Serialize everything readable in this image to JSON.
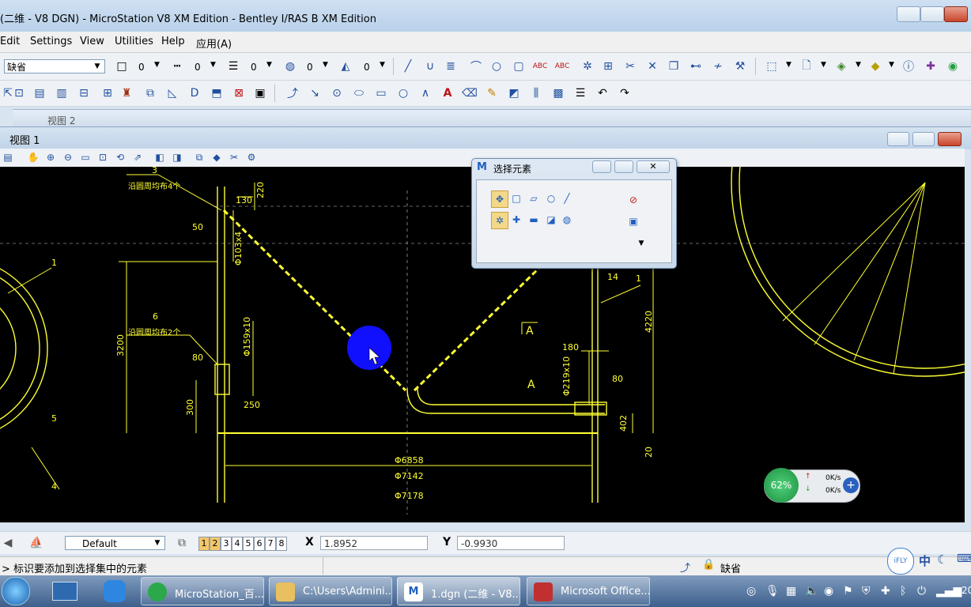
{
  "window": {
    "title": "(二维 - V8 DGN) - MicroStation V8 XM Edition - Bentley I/RAS B XM Edition"
  },
  "menubar": {
    "items": [
      "Edit",
      "Settings",
      "View",
      "Utilities",
      "Help",
      "应用(A)"
    ]
  },
  "toolbar1": {
    "level_combo": "缺省",
    "color_value": "0",
    "style_value": "0",
    "weight_value": "0",
    "transparency_value": "0",
    "priority_value": "0"
  },
  "views": {
    "view2_title": "视图 2",
    "view1_title": "视图 1"
  },
  "drawing": {
    "labels": [
      {
        "name": "label-3",
        "text": "3"
      },
      {
        "name": "label-sleeve4",
        "text": "沿圆周均布4个"
      },
      {
        "name": "label-130",
        "text": "130"
      },
      {
        "name": "label-220",
        "text": "220"
      },
      {
        "name": "label-50",
        "text": "50"
      },
      {
        "name": "label-d103",
        "text": "Φ103x4"
      },
      {
        "name": "label-1-left",
        "text": "1"
      },
      {
        "name": "label-6",
        "text": "6"
      },
      {
        "name": "label-sleeve2",
        "text": "沿圆周均布2个"
      },
      {
        "name": "label-3200",
        "text": "3200"
      },
      {
        "name": "label-80-left",
        "text": "80"
      },
      {
        "name": "label-d159",
        "text": "Φ159x10"
      },
      {
        "name": "label-250",
        "text": "250"
      },
      {
        "name": "label-300",
        "text": "300"
      },
      {
        "name": "label-d6858",
        "text": "Φ6858"
      },
      {
        "name": "label-d7142",
        "text": "Φ7142"
      },
      {
        "name": "label-d7178",
        "text": "Φ7178"
      },
      {
        "name": "label-4",
        "text": "4"
      },
      {
        "name": "label-5",
        "text": "5"
      },
      {
        "name": "label-A-top",
        "text": "A"
      },
      {
        "name": "label-A-bottom",
        "text": "A"
      },
      {
        "name": "label-180",
        "text": "180"
      },
      {
        "name": "label-d219",
        "text": "Φ219x10"
      },
      {
        "name": "label-80-right",
        "text": "80"
      },
      {
        "name": "label-14",
        "text": "14"
      },
      {
        "name": "label-1-right",
        "text": "1"
      },
      {
        "name": "label-4220",
        "text": "4220"
      },
      {
        "name": "label-402",
        "text": "402"
      },
      {
        "name": "label-20",
        "text": "20"
      }
    ]
  },
  "dialog": {
    "title": "选择元素"
  },
  "speed": {
    "percent": "62%",
    "up": "0K/s",
    "down": "0K/s"
  },
  "viewbar": {
    "level_combo": "Default",
    "view_numbers": [
      "1",
      "2",
      "3",
      "4",
      "5",
      "6",
      "7",
      "8"
    ],
    "x_label": "X",
    "x_value": "1.8952",
    "y_label": "Y",
    "y_value": "-0.9930"
  },
  "status": {
    "message": "> 标识要添加到选择集中的元素",
    "level": "缺省"
  },
  "tray": {
    "ime": "中"
  },
  "taskbar": {
    "items": [
      "MicroStation_百...",
      "C:\\Users\\Admini...",
      "1.dgn (二维 - V8...",
      "Microsoft Office..."
    ],
    "clock": "20"
  },
  "colors": {
    "drawing_yellow": "#ffff33",
    "canvas_bg": "#000000",
    "cursor_blue": "#1010ff"
  }
}
